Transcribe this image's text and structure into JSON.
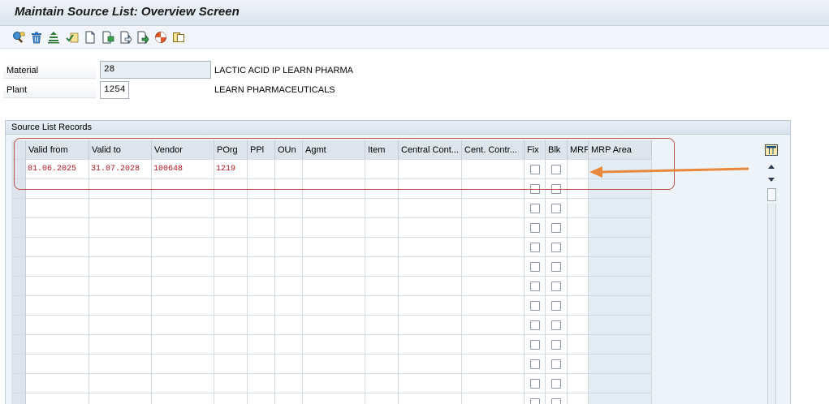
{
  "window": {
    "title": "Maintain Source List: Overview Screen"
  },
  "toolbar": {
    "icons": [
      "display-change-icon",
      "delete-icon",
      "generate-icon",
      "check-icon",
      "new-entry-icon",
      "copy-icon",
      "import-icon",
      "export-icon",
      "analysis-icon",
      "select-icon"
    ]
  },
  "header": {
    "material": {
      "label": "Material",
      "value": "28",
      "description": "LACTIC ACID IP LEARN PHARMA"
    },
    "plant": {
      "label": "Plant",
      "value": "1254",
      "description": "LEARN PHARMACEUTICALS"
    }
  },
  "records": {
    "title": "Source List Records",
    "columns": [
      "Valid from",
      "Valid to",
      "Vendor",
      "POrg",
      "PPl",
      "OUn",
      "Agmt",
      "Item",
      "Central Cont...",
      "Cent. Contr...",
      "Fix",
      "Blk",
      "MRP",
      "MRP Area"
    ],
    "rows": [
      {
        "valid_from": "01.06.2025",
        "valid_to": "31.07.2028",
        "vendor": "100648",
        "porg": "1219",
        "fix": false,
        "blk": false
      }
    ],
    "empty_row_count": 12
  },
  "annotation": {
    "color": "#e8883c",
    "highlight_color": "#c0504d"
  }
}
